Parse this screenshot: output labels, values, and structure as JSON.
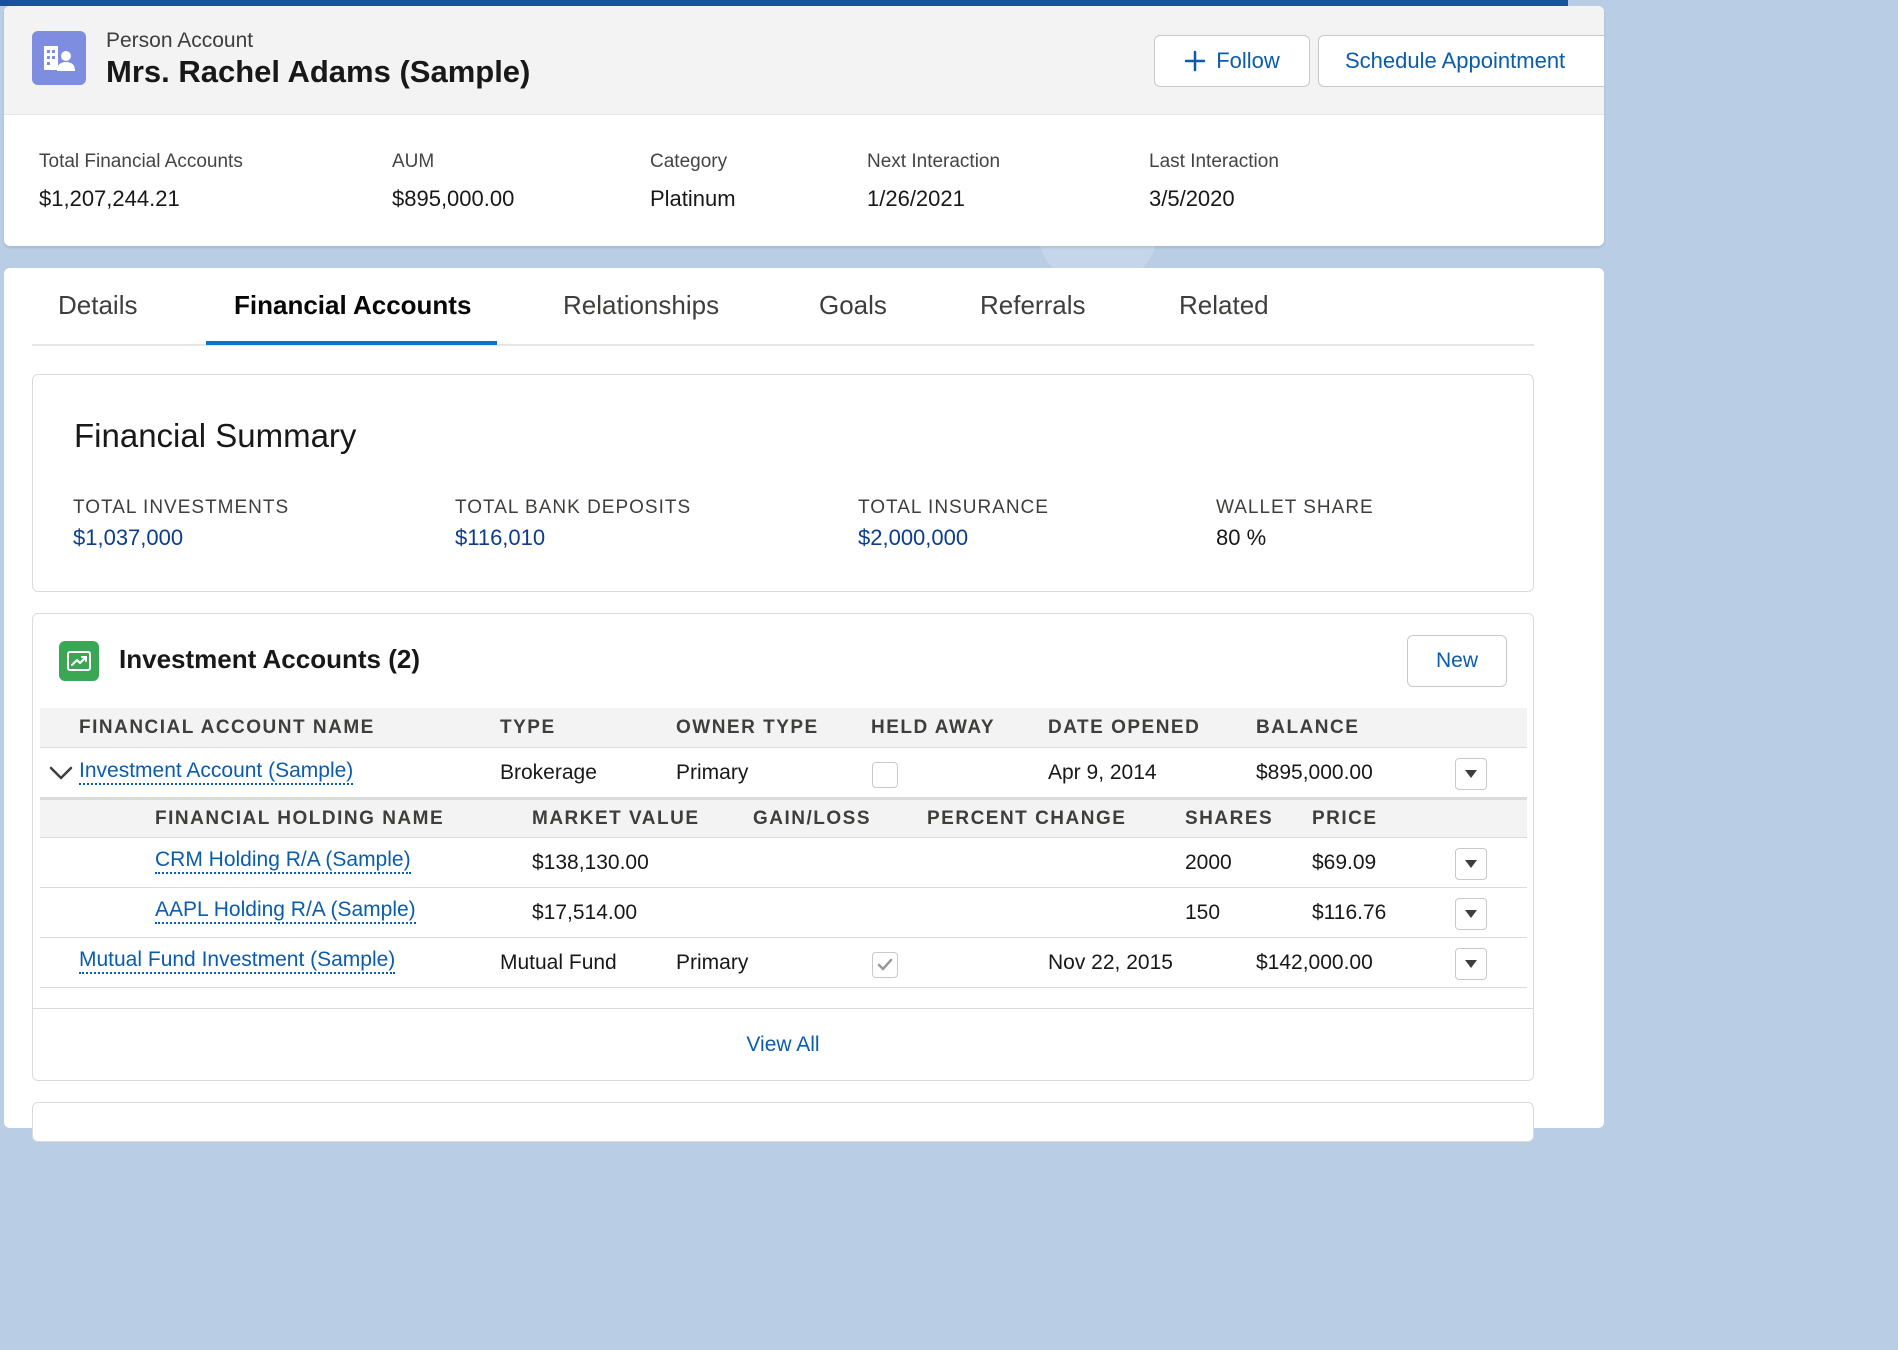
{
  "header": {
    "object_type": "Person Account",
    "record_name": "Mrs. Rachel Adams (Sample)",
    "follow_label": "Follow",
    "schedule_label": "Schedule Appointment"
  },
  "highlights": [
    {
      "label": "Total Financial Accounts",
      "value": "$1,207,244.21"
    },
    {
      "label": "AUM",
      "value": "$895,000.00"
    },
    {
      "label": "Category",
      "value": "Platinum"
    },
    {
      "label": "Next Interaction",
      "value": "1/26/2021"
    },
    {
      "label": "Last Interaction",
      "value": "3/5/2020"
    }
  ],
  "tabs": [
    {
      "label": "Details",
      "active": false
    },
    {
      "label": "Financial Accounts",
      "active": true
    },
    {
      "label": "Relationships",
      "active": false
    },
    {
      "label": "Goals",
      "active": false
    },
    {
      "label": "Referrals",
      "active": false
    },
    {
      "label": "Related",
      "active": false
    }
  ],
  "financial_summary": {
    "title": "Financial Summary",
    "items": [
      {
        "label": "TOTAL INVESTMENTS",
        "value": "$1,037,000"
      },
      {
        "label": "TOTAL BANK DEPOSITS",
        "value": "$116,010"
      },
      {
        "label": "TOTAL INSURANCE",
        "value": "$2,000,000"
      },
      {
        "label": "WALLET SHARE",
        "value": "80 %"
      }
    ]
  },
  "investment_accounts": {
    "title": "Investment Accounts (2)",
    "new_label": "New",
    "columns": [
      "FINANCIAL ACCOUNT NAME",
      "TYPE",
      "OWNER TYPE",
      "HELD AWAY",
      "DATE OPENED",
      "BALANCE"
    ],
    "sub_columns": [
      "FINANCIAL HOLDING NAME",
      "MARKET VALUE",
      "GAIN/LOSS",
      "PERCENT CHANGE",
      "SHARES",
      "PRICE"
    ],
    "accounts": [
      {
        "name": "Investment Account (Sample)",
        "type": "Brokerage",
        "owner_type": "Primary",
        "held_away": false,
        "date_opened": "Apr 9, 2014",
        "balance": "$895,000.00"
      },
      {
        "name": "Mutual Fund Investment (Sample)",
        "type": "Mutual Fund",
        "owner_type": "Primary",
        "held_away": true,
        "date_opened": "Nov 22, 2015",
        "balance": "$142,000.00"
      }
    ],
    "holdings": [
      {
        "name": "CRM Holding R/A (Sample)",
        "market_value": "$138,130.00",
        "gain_loss": "",
        "percent_change": "",
        "shares": "2000",
        "price": "$69.09"
      },
      {
        "name": "AAPL Holding R/A (Sample)",
        "market_value": "$17,514.00",
        "gain_loss": "",
        "percent_change": "",
        "shares": "150",
        "price": "$116.76"
      }
    ],
    "view_all_label": "View All"
  },
  "colors": {
    "brand_blue": "#0176d3",
    "link_blue": "#0b5cab",
    "person_account_icon": "#7f8de1",
    "investment_icon": "#3ba755"
  },
  "icons": {
    "record": "person-account-icon",
    "follow": "plus-icon",
    "section": "investment-chart-icon",
    "expand": "chevron-down-icon",
    "row_menu": "caret-down-icon",
    "checked": "check-icon"
  }
}
